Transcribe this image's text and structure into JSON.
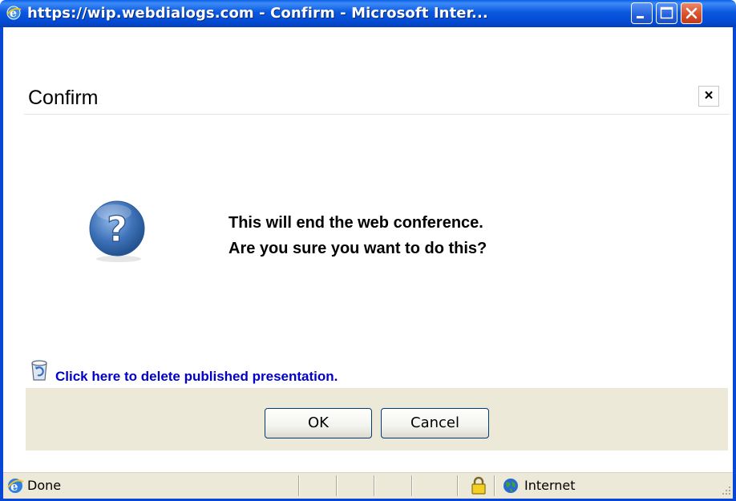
{
  "window": {
    "title": "https://wip.webdialogs.com - Confirm - Microsoft Inter...",
    "controls": [
      "minimize",
      "maximize",
      "close"
    ]
  },
  "dialog": {
    "title": "Confirm",
    "close_label": "×",
    "message_line1": "This will end the web conference.",
    "message_line2": "Are you sure you want to do this?",
    "icon": "question-icon",
    "delete_link": "Click here to delete published presentation.",
    "ok_label": "OK",
    "cancel_label": "Cancel"
  },
  "status": {
    "text": "Done",
    "zone": "Internet"
  },
  "colors": {
    "titlebar": "#0a58e0",
    "link": "#0000c8",
    "button_bar": "#ece9d8"
  }
}
